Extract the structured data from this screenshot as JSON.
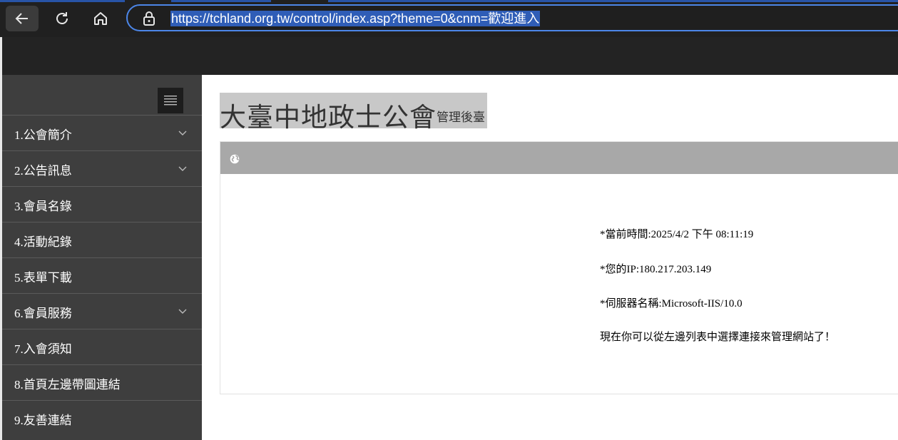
{
  "browser": {
    "url": "https://tchland.org.tw/control/index.asp?theme=0&cnm=歡迎進入"
  },
  "sidebar": {
    "items": [
      {
        "label": "1.公會簡介",
        "expandable": true
      },
      {
        "label": "2.公告訊息",
        "expandable": true
      },
      {
        "label": "3.會員名錄",
        "expandable": false
      },
      {
        "label": "4.活動紀錄",
        "expandable": false
      },
      {
        "label": "5.表單下載",
        "expandable": false
      },
      {
        "label": "6.會員服務",
        "expandable": true
      },
      {
        "label": "7.入會須知",
        "expandable": false
      },
      {
        "label": "8.首頁左邊帶圖連結",
        "expandable": false
      },
      {
        "label": "9.友善連結",
        "expandable": false
      }
    ]
  },
  "main": {
    "title": "大臺中地政士公會",
    "subtitle": "管理後臺",
    "info": {
      "time": "*當前時間:2025/4/2 下午 08:11:19",
      "ip": "*您的IP:180.217.203.149",
      "server": "*伺服器名稱:Microsoft-IIS/10.0",
      "message": "現在你可以從左邊列表中選擇連接來管理網站了！"
    }
  },
  "colors": {
    "accent": "#4c86e8",
    "sidebar_bg": "#3e3e3e",
    "header_bg": "#232323",
    "panel_head": "#a8a8a8"
  }
}
